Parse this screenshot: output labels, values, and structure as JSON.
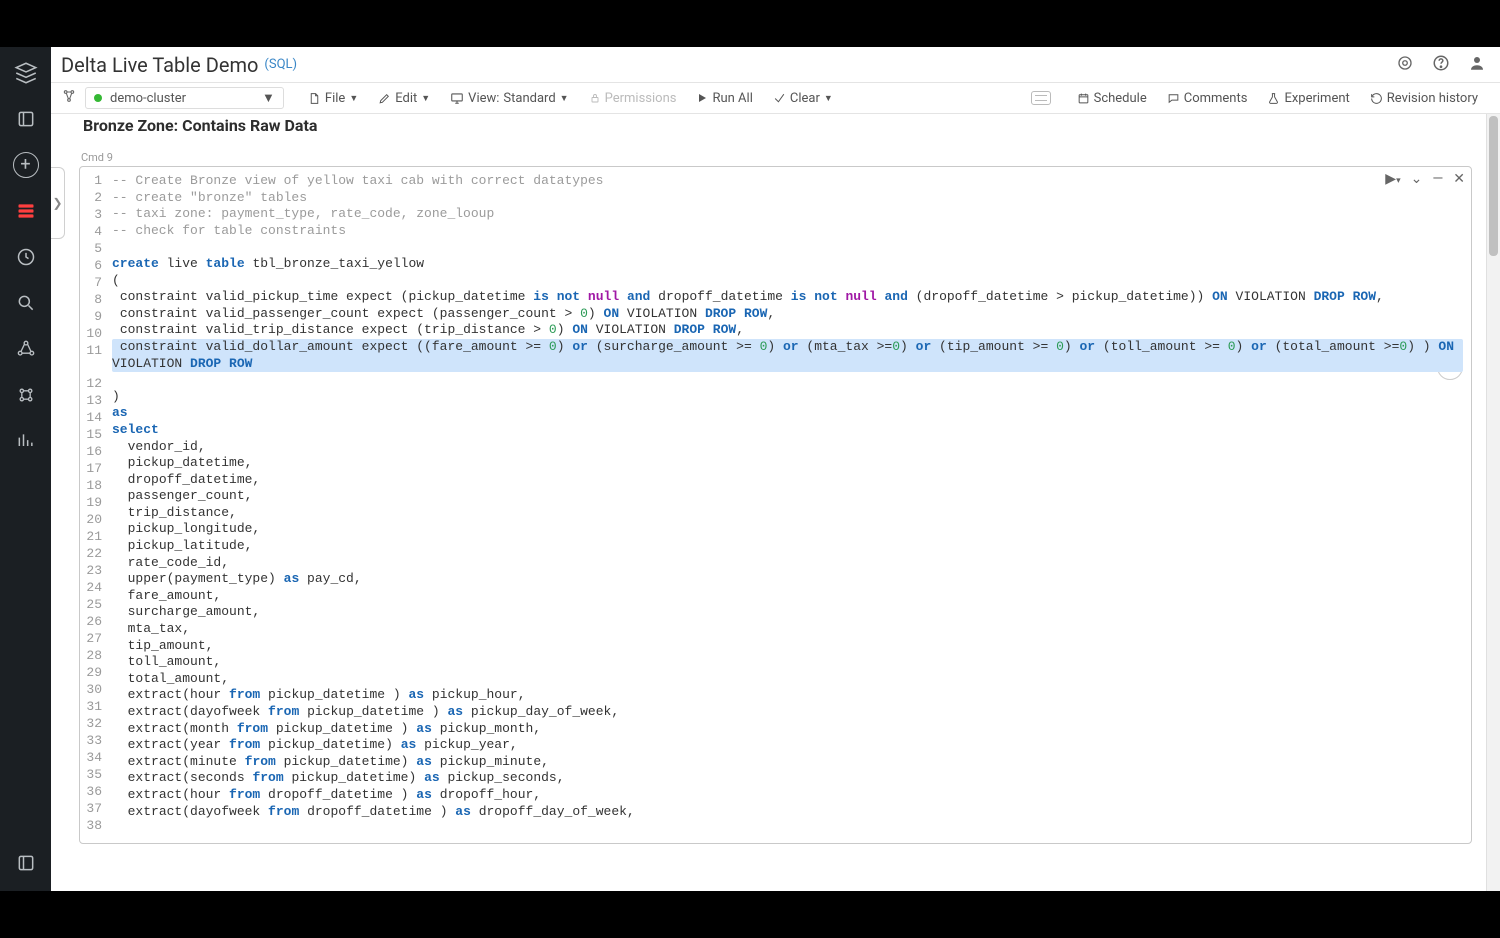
{
  "header": {
    "title": "Delta Live Table Demo",
    "language": "(SQL)"
  },
  "toolbar": {
    "cluster": "demo-cluster",
    "file": "File",
    "edit": "Edit",
    "view_label": "View:",
    "view_mode": "Standard",
    "permissions": "Permissions",
    "run_all": "Run All",
    "clear": "Clear",
    "schedule": "Schedule",
    "comments": "Comments",
    "experiment": "Experiment",
    "revision": "Revision history"
  },
  "md_heading": "Bronze Zone: Contains Raw Data",
  "cmd_label": "Cmd 9",
  "code": {
    "lines": [
      {
        "n": 1,
        "tokens": [
          {
            "t": "-- Create Bronze view of yellow taxi cab with correct datatypes",
            "c": "tok-cm"
          }
        ]
      },
      {
        "n": 2,
        "tokens": [
          {
            "t": "-- create \"bronze\" tables",
            "c": "tok-cm"
          }
        ]
      },
      {
        "n": 3,
        "tokens": [
          {
            "t": "-- taxi zone: payment_type, rate_code, zone_looup",
            "c": "tok-cm"
          }
        ]
      },
      {
        "n": 4,
        "tokens": [
          {
            "t": "-- check for table constraints",
            "c": "tok-cm"
          }
        ]
      },
      {
        "n": 5,
        "tokens": []
      },
      {
        "n": 6,
        "tokens": [
          {
            "t": "create",
            "c": "tok-kw"
          },
          {
            "t": " live "
          },
          {
            "t": "table",
            "c": "tok-kw"
          },
          {
            "t": " tbl_bronze_taxi_yellow"
          }
        ]
      },
      {
        "n": 7,
        "tokens": [
          {
            "t": "("
          }
        ]
      },
      {
        "n": 8,
        "tokens": [
          {
            "t": " constraint valid_pickup_time expect (pickup_datetime "
          },
          {
            "t": "is",
            "c": "tok-kw"
          },
          {
            "t": " "
          },
          {
            "t": "not",
            "c": "tok-kw"
          },
          {
            "t": " "
          },
          {
            "t": "null",
            "c": "tok-kw2"
          },
          {
            "t": " "
          },
          {
            "t": "and",
            "c": "tok-kw"
          },
          {
            "t": " dropoff_datetime "
          },
          {
            "t": "is",
            "c": "tok-kw"
          },
          {
            "t": " "
          },
          {
            "t": "not",
            "c": "tok-kw"
          },
          {
            "t": " "
          },
          {
            "t": "null",
            "c": "tok-kw2"
          },
          {
            "t": " "
          },
          {
            "t": "and",
            "c": "tok-kw"
          },
          {
            "t": " (dropoff_datetime > pickup_datetime)) "
          },
          {
            "t": "ON",
            "c": "tok-kw"
          },
          {
            "t": " VIOLATION "
          },
          {
            "t": "DROP",
            "c": "tok-kw"
          },
          {
            "t": " "
          },
          {
            "t": "ROW",
            "c": "tok-kw"
          },
          {
            "t": ","
          }
        ]
      },
      {
        "n": 9,
        "tokens": [
          {
            "t": " constraint valid_passenger_count expect (passenger_count > "
          },
          {
            "t": "0",
            "c": "tok-num"
          },
          {
            "t": ") "
          },
          {
            "t": "ON",
            "c": "tok-kw"
          },
          {
            "t": " VIOLATION "
          },
          {
            "t": "DROP",
            "c": "tok-kw"
          },
          {
            "t": " "
          },
          {
            "t": "ROW",
            "c": "tok-kw"
          },
          {
            "t": ","
          }
        ]
      },
      {
        "n": 10,
        "tokens": [
          {
            "t": " constraint valid_trip_distance expect (trip_distance > "
          },
          {
            "t": "0",
            "c": "tok-num"
          },
          {
            "t": ") "
          },
          {
            "t": "ON",
            "c": "tok-kw"
          },
          {
            "t": " VIOLATION "
          },
          {
            "t": "DROP",
            "c": "tok-kw"
          },
          {
            "t": " "
          },
          {
            "t": "ROW",
            "c": "tok-kw"
          },
          {
            "t": ","
          }
        ]
      },
      {
        "n": 11,
        "sel": true,
        "tokens": [
          {
            "t": " constraint valid_dollar_amount expect ((fare_amount >= "
          },
          {
            "t": "0",
            "c": "tok-num"
          },
          {
            "t": ") "
          },
          {
            "t": "or",
            "c": "tok-kw"
          },
          {
            "t": " (surcharge_amount >= "
          },
          {
            "t": "0",
            "c": "tok-num"
          },
          {
            "t": ") "
          },
          {
            "t": "or",
            "c": "tok-kw"
          },
          {
            "t": " (mta_tax >="
          },
          {
            "t": "0",
            "c": "tok-num"
          },
          {
            "t": ") "
          },
          {
            "t": "or",
            "c": "tok-kw"
          },
          {
            "t": " (tip_amount >= "
          },
          {
            "t": "0",
            "c": "tok-num"
          },
          {
            "t": ") "
          },
          {
            "t": "or",
            "c": "tok-kw"
          },
          {
            "t": " (toll_amount >= "
          },
          {
            "t": "0",
            "c": "tok-num"
          },
          {
            "t": ") "
          },
          {
            "t": "or",
            "c": "tok-kw"
          },
          {
            "t": " (total_amount >="
          },
          {
            "t": "0",
            "c": "tok-num"
          },
          {
            "t": ") ) "
          },
          {
            "t": "ON",
            "c": "tok-kw"
          },
          {
            "t": " VIOLATION "
          },
          {
            "t": "DROP",
            "c": "tok-kw"
          },
          {
            "t": " "
          },
          {
            "t": "ROW",
            "c": "tok-kw"
          }
        ]
      },
      {
        "n": 12,
        "tokens": []
      },
      {
        "n": 13,
        "tokens": [
          {
            "t": ")"
          }
        ]
      },
      {
        "n": 14,
        "tokens": [
          {
            "t": "as",
            "c": "tok-kw"
          }
        ]
      },
      {
        "n": 15,
        "tokens": [
          {
            "t": "select",
            "c": "tok-kw"
          }
        ]
      },
      {
        "n": 16,
        "tokens": [
          {
            "t": "  vendor_id,"
          }
        ]
      },
      {
        "n": 17,
        "tokens": [
          {
            "t": "  pickup_datetime,"
          }
        ]
      },
      {
        "n": 18,
        "tokens": [
          {
            "t": "  dropoff_datetime,"
          }
        ]
      },
      {
        "n": 19,
        "tokens": [
          {
            "t": "  passenger_count,"
          }
        ]
      },
      {
        "n": 20,
        "tokens": [
          {
            "t": "  trip_distance,"
          }
        ]
      },
      {
        "n": 21,
        "tokens": [
          {
            "t": "  pickup_longitude,"
          }
        ]
      },
      {
        "n": 22,
        "tokens": [
          {
            "t": "  pickup_latitude,"
          }
        ]
      },
      {
        "n": 23,
        "tokens": [
          {
            "t": "  rate_code_id,"
          }
        ]
      },
      {
        "n": 24,
        "tokens": [
          {
            "t": "  upper(payment_type) "
          },
          {
            "t": "as",
            "c": "tok-kw"
          },
          {
            "t": " pay_cd,"
          }
        ]
      },
      {
        "n": 25,
        "tokens": [
          {
            "t": "  fare_amount,"
          }
        ]
      },
      {
        "n": 26,
        "tokens": [
          {
            "t": "  surcharge_amount,"
          }
        ]
      },
      {
        "n": 27,
        "tokens": [
          {
            "t": "  mta_tax,"
          }
        ]
      },
      {
        "n": 28,
        "tokens": [
          {
            "t": "  tip_amount,"
          }
        ]
      },
      {
        "n": 29,
        "tokens": [
          {
            "t": "  toll_amount,"
          }
        ]
      },
      {
        "n": 30,
        "tokens": [
          {
            "t": "  total_amount,"
          }
        ]
      },
      {
        "n": 31,
        "tokens": [
          {
            "t": "  extract(hour "
          },
          {
            "t": "from",
            "c": "tok-kw"
          },
          {
            "t": " pickup_datetime ) "
          },
          {
            "t": "as",
            "c": "tok-kw"
          },
          {
            "t": " pickup_hour,"
          }
        ]
      },
      {
        "n": 32,
        "tokens": [
          {
            "t": "  extract(dayofweek "
          },
          {
            "t": "from",
            "c": "tok-kw"
          },
          {
            "t": " pickup_datetime ) "
          },
          {
            "t": "as",
            "c": "tok-kw"
          },
          {
            "t": " pickup_day_of_week,"
          }
        ]
      },
      {
        "n": 33,
        "tokens": [
          {
            "t": "  extract(month "
          },
          {
            "t": "from",
            "c": "tok-kw"
          },
          {
            "t": " pickup_datetime ) "
          },
          {
            "t": "as",
            "c": "tok-kw"
          },
          {
            "t": " pickup_month,"
          }
        ]
      },
      {
        "n": 34,
        "tokens": [
          {
            "t": "  extract(year "
          },
          {
            "t": "from",
            "c": "tok-kw"
          },
          {
            "t": " pickup_datetime) "
          },
          {
            "t": "as",
            "c": "tok-kw"
          },
          {
            "t": " pickup_year,"
          }
        ]
      },
      {
        "n": 35,
        "tokens": [
          {
            "t": "  extract(minute "
          },
          {
            "t": "from",
            "c": "tok-kw"
          },
          {
            "t": " pickup_datetime) "
          },
          {
            "t": "as",
            "c": "tok-kw"
          },
          {
            "t": " pickup_minute,"
          }
        ]
      },
      {
        "n": 36,
        "tokens": [
          {
            "t": "  extract(seconds "
          },
          {
            "t": "from",
            "c": "tok-kw"
          },
          {
            "t": " pickup_datetime) "
          },
          {
            "t": "as",
            "c": "tok-kw"
          },
          {
            "t": " pickup_seconds,"
          }
        ]
      },
      {
        "n": 37,
        "tokens": [
          {
            "t": "  extract(hour "
          },
          {
            "t": "from",
            "c": "tok-kw"
          },
          {
            "t": " dropoff_datetime ) "
          },
          {
            "t": "as",
            "c": "tok-kw"
          },
          {
            "t": " dropoff_hour,"
          }
        ]
      },
      {
        "n": 38,
        "tokens": [
          {
            "t": "  extract(dayofweek "
          },
          {
            "t": "from",
            "c": "tok-kw"
          },
          {
            "t": " dropoff_datetime ) "
          },
          {
            "t": "as",
            "c": "tok-kw"
          },
          {
            "t": " dropoff_day_of_week,"
          }
        ]
      }
    ]
  }
}
